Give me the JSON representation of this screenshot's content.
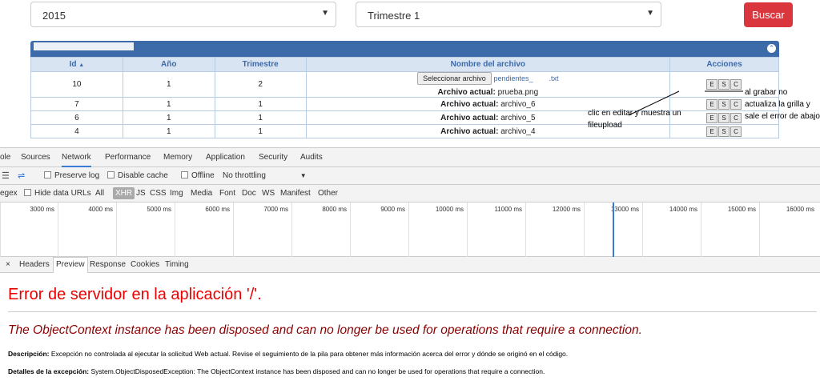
{
  "filters": {
    "year": "2015",
    "quarter": "Trimestre 1",
    "search_label": "Buscar"
  },
  "panel": {
    "toggle_symbol": "⌃"
  },
  "grid": {
    "headers": [
      "Id",
      "Año",
      "Trimestre",
      "Nombre del archivo",
      "Acciones"
    ],
    "sort_indicator": "▲",
    "rows": [
      {
        "id": "10",
        "year": "1",
        "quarter": "2",
        "file_button": "Seleccionar archivo",
        "file_chosen": "pendientes_        .txt",
        "current_label": "Archivo actual:",
        "current_file": "prueba.png"
      },
      {
        "id": "7",
        "year": "1",
        "quarter": "1",
        "current_label": "Archivo actual:",
        "current_file": "archivo_6"
      },
      {
        "id": "6",
        "year": "1",
        "quarter": "1",
        "current_label": "Archivo actual:",
        "current_file": "archivo_5"
      },
      {
        "id": "4",
        "year": "1",
        "quarter": "1",
        "current_label": "Archivo actual:",
        "current_file": "archivo_4"
      }
    ],
    "action_buttons": [
      "E",
      "S",
      "C"
    ]
  },
  "annotations": {
    "left": "clic en editar y muestra un fileupload",
    "right": "al grabar no actualiza la grilla y sale el error de abajo"
  },
  "devtools": {
    "tabs": [
      "ole",
      "Sources",
      "Network",
      "Performance",
      "Memory",
      "Application",
      "Security",
      "Audits"
    ],
    "active_tab": "Network",
    "toolbar": {
      "preserve_log": "Preserve log",
      "disable_cache": "Disable cache",
      "offline": "Offline",
      "throttling": "No throttling"
    },
    "filter": {
      "regex": "egex",
      "hide_data_urls": "Hide data URLs",
      "types": [
        "All",
        "XHR",
        "JS",
        "CSS",
        "Img",
        "Media",
        "Font",
        "Doc",
        "WS",
        "Manifest",
        "Other"
      ],
      "active_type": "XHR"
    },
    "timeline_ticks": [
      "3000 ms",
      "4000 ms",
      "5000 ms",
      "6000 ms",
      "7000 ms",
      "8000 ms",
      "9000 ms",
      "10000 ms",
      "11000 ms",
      "12000 ms",
      "13000 ms",
      "14000 ms",
      "15000 ms",
      "16000 ms"
    ],
    "detail_tabs": [
      "×",
      "Headers",
      "Preview",
      "Response",
      "Cookies",
      "Timing"
    ],
    "active_detail_tab": "Preview"
  },
  "error": {
    "title": "Error de servidor en la aplicación '/'.",
    "message": "The ObjectContext instance has been disposed and can no longer be used for operations that require a connection.",
    "description_label": "Descripción:",
    "description": "Excepción no controlada al ejecutar la solicitud Web actual. Revise el seguimiento de la pila para obtener más información acerca del error y dónde se originó en el código.",
    "details_label": "Detalles de la excepción:",
    "details": "System.ObjectDisposedException: The ObjectContext instance has been disposed and can no longer be used for operations that require a connection."
  }
}
